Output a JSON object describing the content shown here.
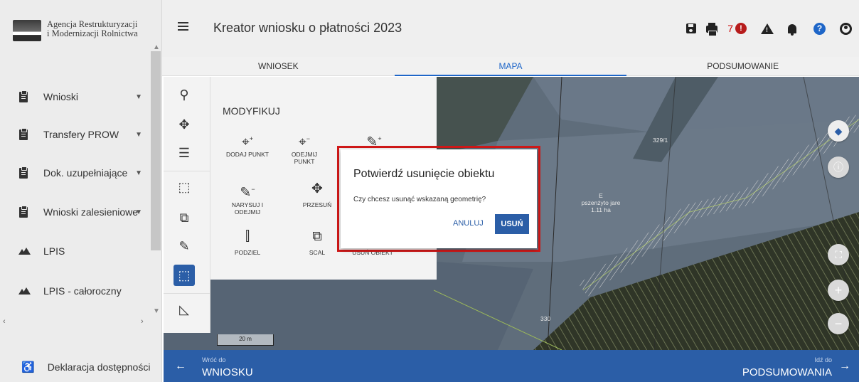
{
  "sidebar": {
    "logo_line1": "Agencja Restrukturyzacji",
    "logo_line2": "i Modernizacji Rolnictwa",
    "logo_mark": "ARiMR",
    "items": [
      {
        "label": "Wnioski",
        "icon": "clipboard-icon",
        "chevron": "⌄"
      },
      {
        "label": "Transfery PROW",
        "icon": "clipboard-icon",
        "chevron": "⌄"
      },
      {
        "label": "Dok. uzupełniające",
        "icon": "clipboard-icon",
        "chevron": "⌄"
      },
      {
        "label": "Wnioski zalesieniowe",
        "icon": "clipboard-icon",
        "chevron": "⌄"
      },
      {
        "label": "LPIS",
        "icon": "mountain-icon"
      },
      {
        "label": "LPIS - całoroczny",
        "icon": "mountain-icon"
      }
    ],
    "accessibility_label": "Deklaracja dostępności"
  },
  "header": {
    "title": "Kreator wniosku o płatności 2023",
    "notification_count": "7",
    "alert_glyph": "!",
    "help_glyph": "?"
  },
  "tabs": [
    {
      "label": "WNIOSEK"
    },
    {
      "label": "MAPA",
      "active": true
    },
    {
      "label": "PODSUMOWANIE"
    }
  ],
  "toolbar": {
    "icons": [
      "search-icon",
      "cursor-icon",
      "list-icon",
      "select-icon",
      "copy-icon",
      "pencil-icon",
      "area-icon",
      "measure-icon"
    ]
  },
  "modify_panel": {
    "title": "MODYFIKUJ",
    "tools": [
      {
        "label": "DODAJ PUNKT"
      },
      {
        "label": "ODEJMIJ PUNKT"
      },
      {
        "label": ""
      },
      {
        "label": "NARYSUJ I ODEJMIJ"
      },
      {
        "label": "PRZESUŃ"
      },
      {
        "label": "PODZIEL"
      },
      {
        "label": "SCAL"
      },
      {
        "label": "USUŃ OBIEKT"
      }
    ]
  },
  "map": {
    "parcel_label_1": "329/1",
    "parcel_label_2": "330",
    "field_code": "E",
    "field_crop": "pszenżyto jare",
    "field_area": "1.11 ha",
    "scale_label": "20 m",
    "colors": {
      "field": "#5d6a77",
      "highlight": "#b9d36a"
    }
  },
  "dialog": {
    "title": "Potwierdź usunięcie obiektu",
    "message": "Czy chcesz usunąć wskazaną geometrię?",
    "cancel_label": "ANULUJ",
    "confirm_label": "USUŃ",
    "accent": "#2b5ea7",
    "highlight_border": "#d01818"
  },
  "bottom_bar": {
    "back_small": "Wróć do",
    "back_big": "WNIOSKU",
    "next_small": "Idź do",
    "next_big": "PODSUMOWANIA"
  }
}
